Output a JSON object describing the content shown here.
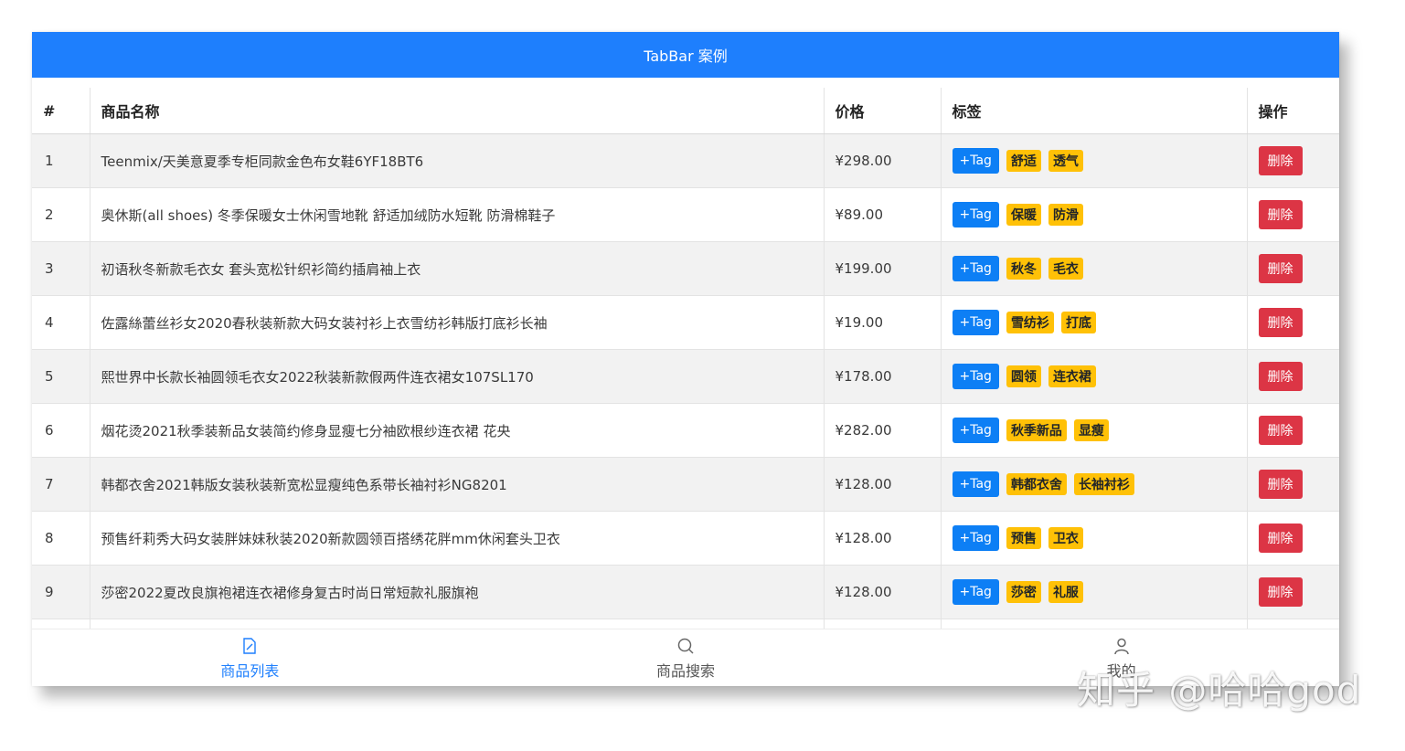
{
  "header": {
    "title": "TabBar 案例"
  },
  "table": {
    "columns": [
      "#",
      "商品名称",
      "价格",
      "标签",
      "操作"
    ],
    "add_tag_label": "+Tag",
    "delete_label": "删除",
    "rows": [
      {
        "id": "1",
        "name": "Teenmix/天美意夏季专柜同款金色布女鞋6YF18BT6",
        "price": "¥298.00",
        "tags": [
          "舒适",
          "透气"
        ]
      },
      {
        "id": "2",
        "name": "奥休斯(all shoes) 冬季保暖女士休闲雪地靴 舒适加绒防水短靴 防滑棉鞋子",
        "price": "¥89.00",
        "tags": [
          "保暖",
          "防滑"
        ]
      },
      {
        "id": "3",
        "name": "初语秋冬新款毛衣女 套头宽松针织衫简约插肩袖上衣",
        "price": "¥199.00",
        "tags": [
          "秋冬",
          "毛衣"
        ]
      },
      {
        "id": "4",
        "name": "佐露絲蕾丝衫女2020春秋装新款大码女装衬衫上衣雪纺衫韩版打底衫长袖",
        "price": "¥19.00",
        "tags": [
          "雪纺衫",
          "打底"
        ]
      },
      {
        "id": "5",
        "name": "熙世界中长款长袖圆领毛衣女2022秋装新款假两件连衣裙女107SL170",
        "price": "¥178.00",
        "tags": [
          "圆领",
          "连衣裙"
        ]
      },
      {
        "id": "6",
        "name": "烟花烫2021秋季装新品女装简约修身显瘦七分袖欧根纱连衣裙 花央",
        "price": "¥282.00",
        "tags": [
          "秋季新品",
          "显瘦"
        ]
      },
      {
        "id": "7",
        "name": "韩都衣舍2021韩版女装秋装新宽松显瘦纯色系带长袖衬衫NG8201",
        "price": "¥128.00",
        "tags": [
          "韩都衣舍",
          "长袖衬衫"
        ]
      },
      {
        "id": "8",
        "name": "预售纤莉秀大码女装胖妹妹秋装2020新款圆领百搭绣花胖mm休闲套头卫衣",
        "price": "¥128.00",
        "tags": [
          "预售",
          "卫衣"
        ]
      },
      {
        "id": "9",
        "name": "莎密2022夏改良旗袍裙连衣裙修身复古时尚日常短款礼服旗袍",
        "price": "¥128.00",
        "tags": [
          "莎密",
          "礼服"
        ]
      },
      {
        "id": "",
        "name": "",
        "price": "",
        "tags": []
      }
    ]
  },
  "tabbar": {
    "items": [
      {
        "label": "商品列表",
        "icon": "edit-icon",
        "active": true
      },
      {
        "label": "商品搜索",
        "icon": "search-icon",
        "active": false
      },
      {
        "label": "我的",
        "icon": "user-icon",
        "active": false
      }
    ]
  },
  "watermark": {
    "text": "知乎 @哈哈god"
  },
  "colors": {
    "accent": "#1e7ffd",
    "tag": "#ffc107",
    "danger": "#dc3545",
    "add_tag": "#0d7ff5"
  }
}
